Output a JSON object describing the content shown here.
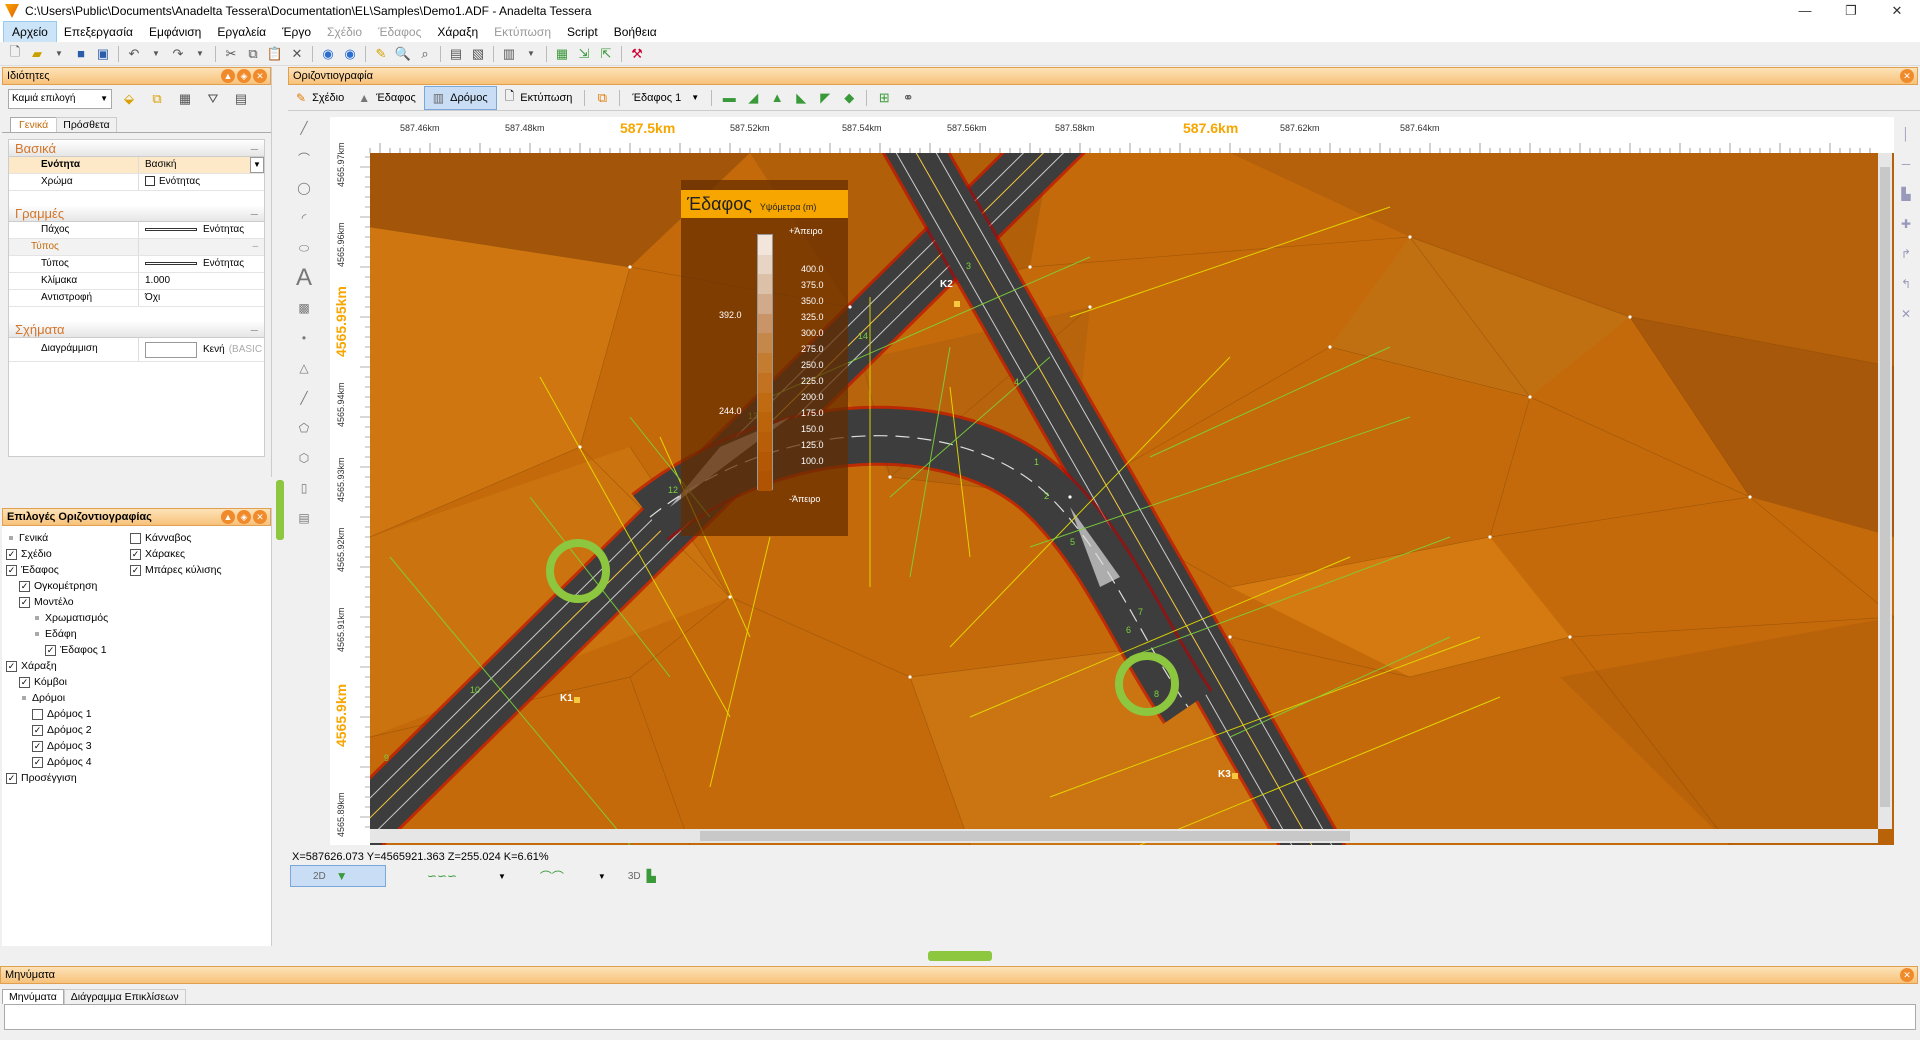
{
  "window": {
    "title": "C:\\Users\\Public\\Documents\\Anadelta Tessera\\Documentation\\EL\\Samples\\Demo1.ADF - Anadelta Tessera",
    "controls": [
      "—",
      "❐",
      "✕"
    ]
  },
  "menu": [
    {
      "label": "Αρχείο",
      "active": true,
      "disabled": false
    },
    {
      "label": "Επεξεργασία",
      "active": false,
      "disabled": false
    },
    {
      "label": "Εμφάνιση",
      "active": false,
      "disabled": false
    },
    {
      "label": "Εργαλεία",
      "active": false,
      "disabled": false
    },
    {
      "label": "Έργο",
      "active": false,
      "disabled": false
    },
    {
      "label": "Σχέδιο",
      "active": false,
      "disabled": true
    },
    {
      "label": "Έδαφος",
      "active": false,
      "disabled": true
    },
    {
      "label": "Χάραξη",
      "active": false,
      "disabled": false
    },
    {
      "label": "Εκτύπωση",
      "active": false,
      "disabled": true
    },
    {
      "label": "Script",
      "active": false,
      "disabled": false
    },
    {
      "label": "Βοήθεια",
      "active": false,
      "disabled": false
    }
  ],
  "properties": {
    "title": "Ιδιότητες",
    "selection": "Καμιά επιλογή",
    "tabs": [
      "Γενικά",
      "Πρόσθετα"
    ],
    "groups": {
      "basic": {
        "title": "Βασικά",
        "rows": [
          {
            "k": "Ενότητα",
            "v": "Βασική"
          },
          {
            "k": "Χρώμα",
            "v": "Ενότητας"
          }
        ]
      },
      "lines": {
        "title": "Γραμμές",
        "rows": [
          {
            "k": "Πάχος",
            "v": "Ενότητας"
          },
          {
            "k": "Τύπος",
            "v": ""
          },
          {
            "k": "Τύπος",
            "v": "Ενότητας"
          },
          {
            "k": "Κλίμακα",
            "v": "1.000"
          },
          {
            "k": "Αντιστροφή",
            "v": "Όχι"
          }
        ]
      },
      "shapes": {
        "title": "Σχήματα",
        "rows": [
          {
            "k": "Διαγράμμιση",
            "v": "Κενή",
            "extra": "(BASIC"
          }
        ]
      }
    }
  },
  "options": {
    "title": "Επιλογές Οριζοντιογραφίας",
    "left": [
      {
        "label": "Γενικά",
        "indent": 0,
        "type": "dot"
      },
      {
        "label": "Σχέδιο",
        "indent": 0,
        "type": "cb",
        "checked": true
      },
      {
        "label": "Έδαφος",
        "indent": 0,
        "type": "cb",
        "checked": true
      },
      {
        "label": "Ογκομέτρηση",
        "indent": 1,
        "type": "cb",
        "checked": true
      },
      {
        "label": "Μοντέλο",
        "indent": 1,
        "type": "cb",
        "checked": true
      },
      {
        "label": "Χρωματισμός",
        "indent": 2,
        "type": "dot"
      },
      {
        "label": "Εδάφη",
        "indent": 2,
        "type": "dot"
      },
      {
        "label": "Έδαφος 1",
        "indent": 3,
        "type": "cb",
        "checked": true
      },
      {
        "label": "Χάραξη",
        "indent": 0,
        "type": "cb",
        "checked": true
      },
      {
        "label": "Κόμβοι",
        "indent": 1,
        "type": "cb",
        "checked": true
      },
      {
        "label": "Δρόμοι",
        "indent": 1,
        "type": "dot"
      },
      {
        "label": "Δρόμος 1",
        "indent": 2,
        "type": "cb",
        "checked": false
      },
      {
        "label": "Δρόμος 2",
        "indent": 2,
        "type": "cb",
        "checked": true
      },
      {
        "label": "Δρόμος 3",
        "indent": 2,
        "type": "cb",
        "checked": true
      },
      {
        "label": "Δρόμος 4",
        "indent": 2,
        "type": "cb",
        "checked": true
      },
      {
        "label": "Προσέγγιση",
        "indent": 0,
        "type": "cb",
        "checked": true
      }
    ],
    "right": [
      {
        "label": "Κάνναβος",
        "checked": false
      },
      {
        "label": "Χάρακες",
        "checked": true
      },
      {
        "label": "Μπάρες κύλισης",
        "checked": true
      }
    ]
  },
  "plan": {
    "title": "Οριζοντιογραφία",
    "toolbar": {
      "sxedio": "Σχέδιο",
      "edafos": "Έδαφος",
      "dromos": "Δρόμος",
      "ektyposi": "Εκτύπωση",
      "terrain_select": "Έδαφος 1"
    },
    "ruler_top": [
      "587.46km",
      "587.48km",
      "587.5km",
      "587.52km",
      "587.54km",
      "587.56km",
      "587.58km",
      "587.6km",
      "587.62km",
      "587.64km"
    ],
    "ruler_left": [
      "4565.97km",
      "4565.96km",
      "4565.95km",
      "4565.94km",
      "4565.93km",
      "4565.92km",
      "4565.91km",
      "4565.9km",
      "4565.89km"
    ],
    "legend": {
      "title": "Έδαφος",
      "subtitle": "Υψόμετρα (m)",
      "top": "+Άπειρο",
      "bottom": "-Άπειρο",
      "marks": [
        "392.0",
        "244.0"
      ],
      "levels": [
        "400.0",
        "375.0",
        "350.0",
        "325.0",
        "300.0",
        "275.0",
        "250.0",
        "225.0",
        "200.0",
        "175.0",
        "150.0",
        "125.0",
        "100.0"
      ]
    },
    "nodes": [
      "K1",
      "K2",
      "K3"
    ],
    "stations": [
      "1",
      "2",
      "3",
      "4",
      "5",
      "6",
      "7",
      "8",
      "9",
      "10",
      "11",
      "12",
      "13",
      "14"
    ],
    "status": "X=587626.073  Y=4565921.363  Z=255.024  K=6.61%",
    "view_tabs": [
      "2D",
      "3D"
    ]
  },
  "messages": {
    "title": "Μηνύματα",
    "tabs": [
      "Μηνύματα",
      "Διάγραμμα Επικλίσεων"
    ]
  },
  "colors": {
    "accent": "#f7a600",
    "terrain": "#c46a0a",
    "road": "#3d3d3d",
    "header": "#f7c27a"
  }
}
